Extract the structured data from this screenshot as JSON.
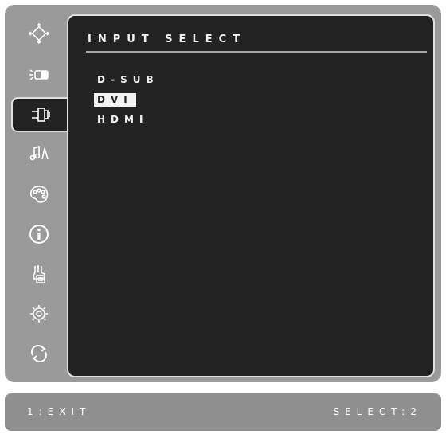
{
  "menu": {
    "title": "INPUT SELECT",
    "options": [
      "D-SUB",
      "DVI",
      "HDMI"
    ],
    "selected": "DVI"
  },
  "sidebar": {
    "items": [
      {
        "icon": "auto-image-adjust-icon"
      },
      {
        "icon": "contrast-brightness-icon"
      },
      {
        "icon": "input-select-icon",
        "active": true
      },
      {
        "icon": "audio-adjust-icon"
      },
      {
        "icon": "color-adjust-icon"
      },
      {
        "icon": "information-icon"
      },
      {
        "icon": "manual-image-adjust-icon"
      },
      {
        "icon": "setup-menu-icon"
      },
      {
        "icon": "memory-recall-icon"
      }
    ]
  },
  "footer": {
    "left": "1:EXIT",
    "right": "SELECT:2"
  },
  "colors": {
    "panel": "#232323",
    "frame": "#9a9a9a",
    "border": "#e0e0e0",
    "text": "#f2f2f2"
  }
}
